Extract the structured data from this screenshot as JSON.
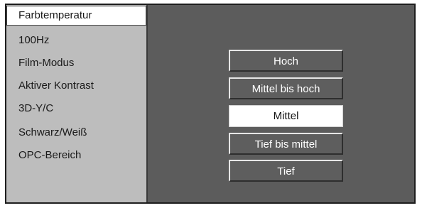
{
  "menu": {
    "items": [
      {
        "label": "Farbtemperatur"
      },
      {
        "label": "100Hz"
      },
      {
        "label": "Film-Modus"
      },
      {
        "label": "Aktiver Kontrast"
      },
      {
        "label": "3D-Y/C"
      },
      {
        "label": "Schwarz/Weiß"
      },
      {
        "label": "OPC-Bereich"
      }
    ],
    "selected": "Farbtemperatur"
  },
  "options": {
    "items": [
      {
        "label": "Hoch"
      },
      {
        "label": "Mittel bis hoch"
      },
      {
        "label": "Mittel"
      },
      {
        "label": "Tief bis mittel"
      },
      {
        "label": "Tief"
      }
    ],
    "selected": "Mittel"
  },
  "colors": {
    "panel_background": "#5c5c5c",
    "sidebar_background": "#bdbdbd",
    "highlight": "#ffffff"
  }
}
